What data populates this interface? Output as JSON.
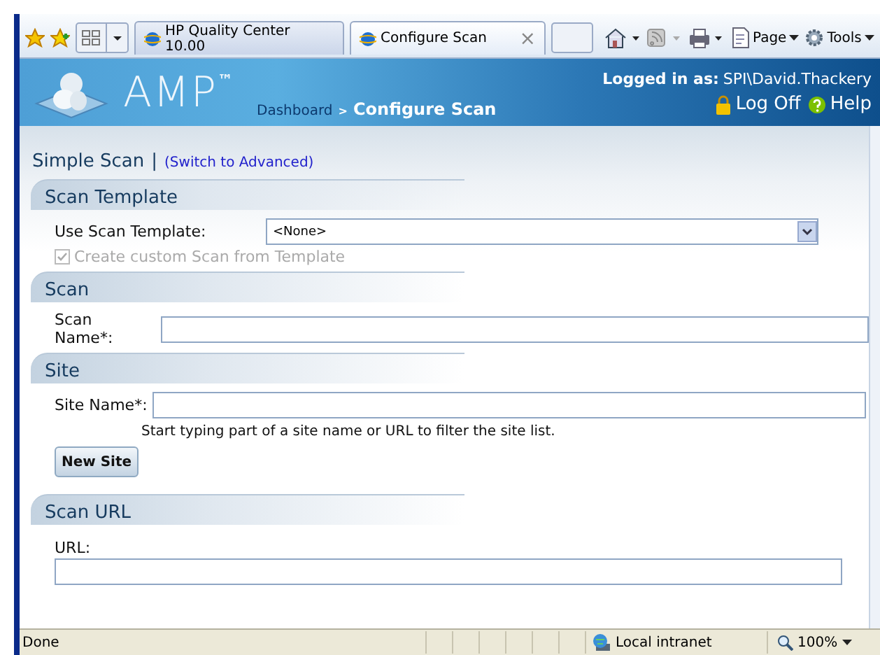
{
  "browser": {
    "tabs": [
      {
        "label": "HP Quality Center 10.00",
        "selected": false
      },
      {
        "label": "Configure Scan",
        "selected": true
      }
    ],
    "close_glyph": "×",
    "commands": [
      {
        "label": "Page"
      },
      {
        "label": "Tools"
      }
    ]
  },
  "header": {
    "logo": "AMP",
    "trademark": "™",
    "breadcrumb": [
      {
        "label": "Dashboard",
        "kind": "link"
      },
      {
        "label": "Configure Scan",
        "kind": "current"
      }
    ],
    "separator": ">",
    "login_label": "Logged in as:",
    "user": "SPI\\David.Thackery",
    "logoff": "Log Off",
    "help": "Help"
  },
  "mode": {
    "title": "Simple Scan",
    "separator": "|",
    "switch_link": "(Switch to Advanced)"
  },
  "sections": [
    {
      "title": "Scan Template",
      "fields": [
        {
          "kind": "select",
          "label": "Use Scan Template:",
          "value": "<None>"
        },
        {
          "kind": "checkbox",
          "label": "Create custom Scan from Template",
          "checked": true,
          "disabled": true
        }
      ]
    },
    {
      "title": "Scan",
      "fields": [
        {
          "kind": "text",
          "label": "Scan Name*:"
        }
      ]
    },
    {
      "title": "Site",
      "fields": [
        {
          "kind": "text",
          "label": "Site Name*:",
          "hint": "Start typing part of a site name or URL to filter the site list."
        },
        {
          "kind": "button",
          "label": "New Site"
        }
      ]
    },
    {
      "title": "Scan URL",
      "fields": [
        {
          "kind": "stacked",
          "label": "URL:"
        }
      ]
    }
  ],
  "status_bar": {
    "text": "Done",
    "zone": "Local intranet",
    "zoom": "100%"
  }
}
